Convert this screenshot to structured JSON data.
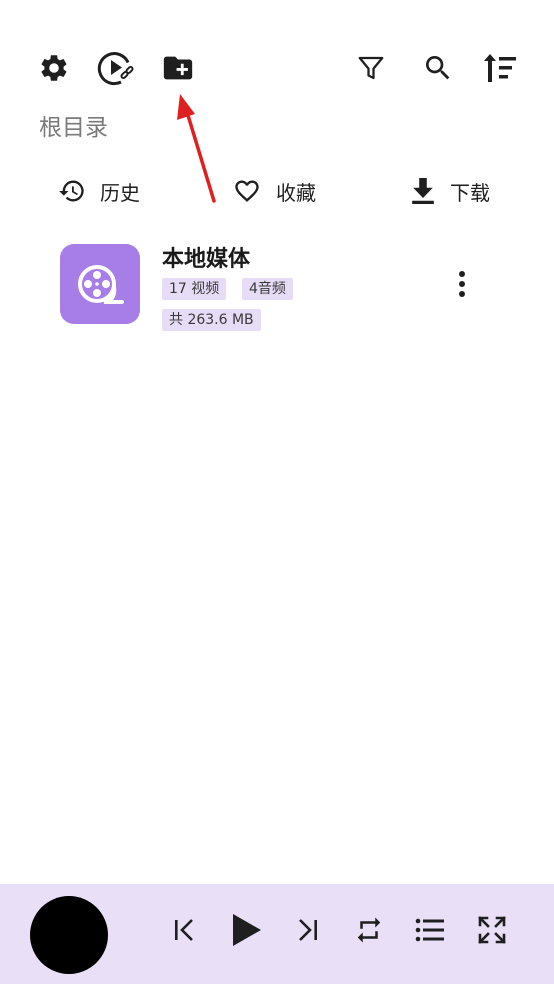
{
  "toolbar": {
    "left_icons": [
      "settings-icon",
      "play-link-icon",
      "folder-add-icon"
    ],
    "right_icons": [
      "filter-icon",
      "search-icon",
      "sort-icon"
    ]
  },
  "breadcrumb": {
    "label": "根目录"
  },
  "quick_actions": [
    {
      "icon": "history-icon",
      "label": "历史"
    },
    {
      "icon": "heart-icon",
      "label": "收藏"
    },
    {
      "icon": "download-icon",
      "label": "下载"
    }
  ],
  "media_library": {
    "title": "本地媒体",
    "video_count": "17 视频",
    "audio_count": "4音频",
    "total_size": "共 263.6 MB",
    "accent_color": "#a77de8",
    "tag_color": "#e6dcf6"
  },
  "player": {
    "background": "#e9e0f8",
    "controls": [
      "previous-icon",
      "play-icon",
      "next-icon",
      "repeat-icon",
      "playlist-icon",
      "fullscreen-icon"
    ]
  },
  "annotation": {
    "arrow_color": "#e02020"
  }
}
